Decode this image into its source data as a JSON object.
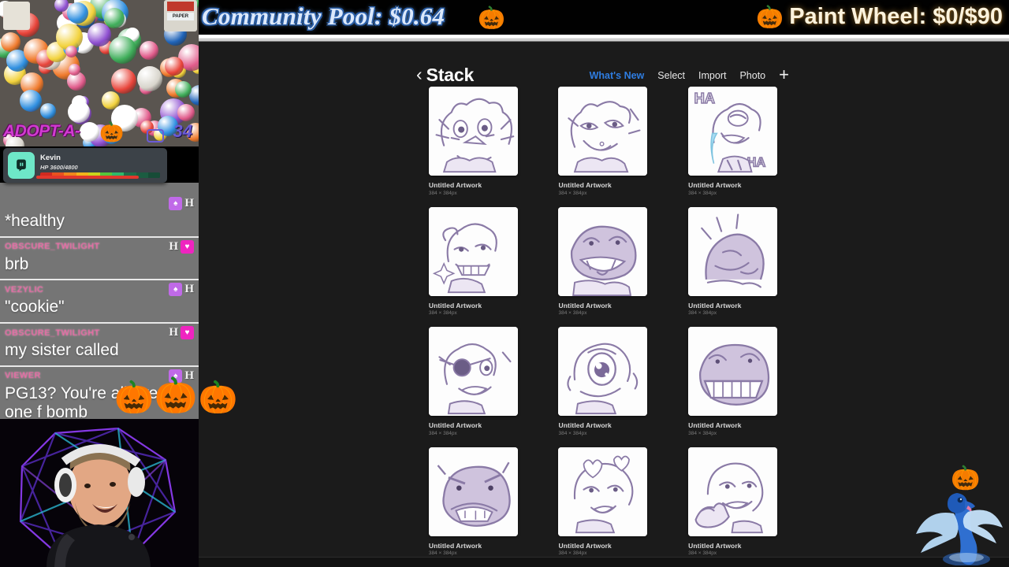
{
  "banner": {
    "pool_label": "Community Pool: $0.64",
    "pool_icon": "pumpkin-icon",
    "pool_emoji": "🎃",
    "wheel_label": "Paint Wheel: $0/$90",
    "wheel_emoji": "🎃",
    "pool_text_color": "#dce9fb",
    "wheel_text_color": "#fdf3dd"
  },
  "app": {
    "back_chevron": "‹",
    "title": "Stack",
    "nav": [
      {
        "label": "What's New",
        "accent": true
      },
      {
        "label": "Select",
        "accent": false
      },
      {
        "label": "Import",
        "accent": false
      },
      {
        "label": "Photo",
        "accent": false
      }
    ],
    "add_icon": "+",
    "accent_color": "#2f7de1",
    "artworks": [
      {
        "title": "Untitled Artwork",
        "size": "384 × 384px",
        "art": "dragon-wide-eyes"
      },
      {
        "title": "Untitled Artwork",
        "size": "384 × 384px",
        "art": "dragon-smug"
      },
      {
        "title": "Untitled Artwork",
        "size": "384 × 384px",
        "art": "dragon-laughing-ha"
      },
      {
        "title": "Untitled Artwork",
        "size": "384 × 384px",
        "art": "dragon-sparkle-grin"
      },
      {
        "title": "Untitled Artwork",
        "size": "384 × 384px",
        "art": "dragon-open-mouth"
      },
      {
        "title": "Untitled Artwork",
        "size": "384 × 384px",
        "art": "dragon-turned-away"
      },
      {
        "title": "Untitled Artwork",
        "size": "384 × 384px",
        "art": "dragon-eyepatch"
      },
      {
        "title": "Untitled Artwork",
        "size": "384 × 384px",
        "art": "dragon-big-eye"
      },
      {
        "title": "Untitled Artwork",
        "size": "384 × 384px",
        "art": "dragon-wide-grin"
      },
      {
        "title": "Untitled Artwork",
        "size": "384 × 384px",
        "art": "dragon-angry"
      },
      {
        "title": "Untitled Artwork",
        "size": "384 × 384px",
        "art": "dragon-hearts"
      },
      {
        "title": "Untitled Artwork",
        "size": "384 × 384px",
        "art": "dragon-pointing"
      }
    ]
  },
  "game_overlay": {
    "title": "ADOPT-A-",
    "pumpkin_emoji": "🎃",
    "count": "34",
    "title_color": "#d13bd1",
    "count_color": "#6a5bd6"
  },
  "player_card": {
    "name": "Kevin",
    "hp_label": "HP 3600/4800",
    "avatar_icon": "streamlabs-icon",
    "avatar_color": "#6ee7c8"
  },
  "chat": {
    "messages": [
      {
        "user": "",
        "text": "*healthy",
        "badges": [
          {
            "type": "square-purple",
            "glyph": "♠"
          },
          {
            "type": "letter-h",
            "glyph": "H"
          }
        ]
      },
      {
        "user": "OBSCURE_TWILIGHT",
        "text": "brb",
        "badges": [
          {
            "type": "letter-h",
            "glyph": "H"
          },
          {
            "type": "square-pink",
            "glyph": "♥"
          }
        ]
      },
      {
        "user": "VEZYLIC",
        "text": "\"cookie\"",
        "badges": [
          {
            "type": "square-purple",
            "glyph": "♠"
          },
          {
            "type": "letter-h",
            "glyph": "H"
          }
        ]
      },
      {
        "user": "OBSCURE_TWILIGHT",
        "text": "my sister called",
        "badges": [
          {
            "type": "letter-h",
            "glyph": "H"
          },
          {
            "type": "square-pink",
            "glyph": "♥"
          }
        ]
      },
      {
        "user": "VIEWER",
        "text": "PG13? You're allowed one f bomb",
        "badges": [
          {
            "type": "square-purple",
            "glyph": "♠"
          },
          {
            "type": "letter-h",
            "glyph": "H"
          }
        ]
      }
    ],
    "overlay_emojis": [
      "🎃",
      "🎃",
      "🎃"
    ]
  },
  "webcam": {
    "alt": "streamer-webcam"
  },
  "mascot": {
    "alt": "blue-bird-mascot",
    "pumpkin_emoji": "🎃"
  }
}
